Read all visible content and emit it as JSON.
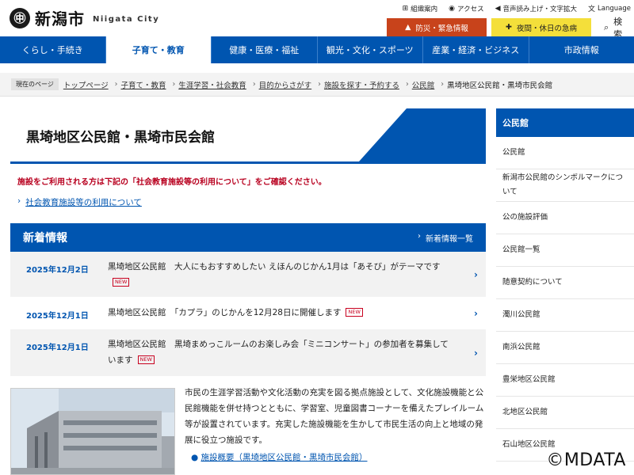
{
  "header": {
    "logo_mark": "㊥",
    "logo_ja": "新潟市",
    "logo_en": "Niigata City",
    "util": [
      {
        "icon": "sitemap-icon",
        "glyph": "⊞",
        "label": "組織案内"
      },
      {
        "icon": "pin-icon",
        "glyph": "◉",
        "label": "アクセス"
      },
      {
        "icon": "speaker-icon",
        "glyph": "◀",
        "label": "音声読み上げ・文字拡大"
      },
      {
        "icon": "language-icon",
        "glyph": "文",
        "label": "Language"
      }
    ],
    "emergency": "防災・緊急情報",
    "medical": "夜間・休日の急病",
    "search": "検索"
  },
  "nav": [
    {
      "label": "くらし・手続き",
      "active": false
    },
    {
      "label": "子育て・教育",
      "active": true
    },
    {
      "label": "健康・医療・福祉",
      "active": false
    },
    {
      "label": "観光・文化・スポーツ",
      "active": false
    },
    {
      "label": "産業・経済・ビジネス",
      "active": false
    },
    {
      "label": "市政情報",
      "active": false
    }
  ],
  "breadcrumb": {
    "here": "現在のページ",
    "items": [
      "トップページ",
      "子育て・教育",
      "生涯学習・社会教育",
      "目的からさがす",
      "施設を探す・予約する",
      "公民館"
    ],
    "current": "黒埼地区公民館・黒埼市民会館"
  },
  "page_title": "黒埼地区公民館・黒埼市民会館",
  "notice": "施設をご利用される方は下記の「社会教育施設等の利用について」をご確認ください。",
  "notice_link": "社会教育施設等の利用について",
  "news": {
    "title": "新着情報",
    "list_link": "新着情報一覧",
    "new_badge": "NEW",
    "items": [
      {
        "date": "2025年12月2日",
        "text": "黒埼地区公民館　大人にもおすすめしたい えほんのじかん1月は「あそび」がテーマです"
      },
      {
        "date": "2025年12月1日",
        "text": "黒埼地区公民館　「カプラ」のじかんを12月28日に開催します"
      },
      {
        "date": "2025年12月1日",
        "text": "黒埼地区公民館　黒埼まめっこルームのお楽しみ会「ミニコンサート」の参加者を募集しています"
      }
    ]
  },
  "description": "市民の生涯学習活動や文化活動の充実を図る拠点施設として、文化施設機能と公民館機能を併せ持つとともに、学習室、児童図書コーナーを備えたプレイルーム等が設置されています。充実した施設機能を生かして市民生活の向上と地域の発展に役立つ施設です。",
  "desc_link": "施設概要（黒埼地区公民館・黒埼市民会館）",
  "sidebar": {
    "title": "公民館",
    "items": [
      "公民館",
      "新潟市公民館のシンボルマークについて",
      "公の施設評価",
      "公民館一覧",
      "随意契約について",
      "濁川公民館",
      "南浜公民館",
      "豊栄地区公民館",
      "北地区公民館",
      "石山地区公民館"
    ]
  },
  "watermark": "©MDATA"
}
